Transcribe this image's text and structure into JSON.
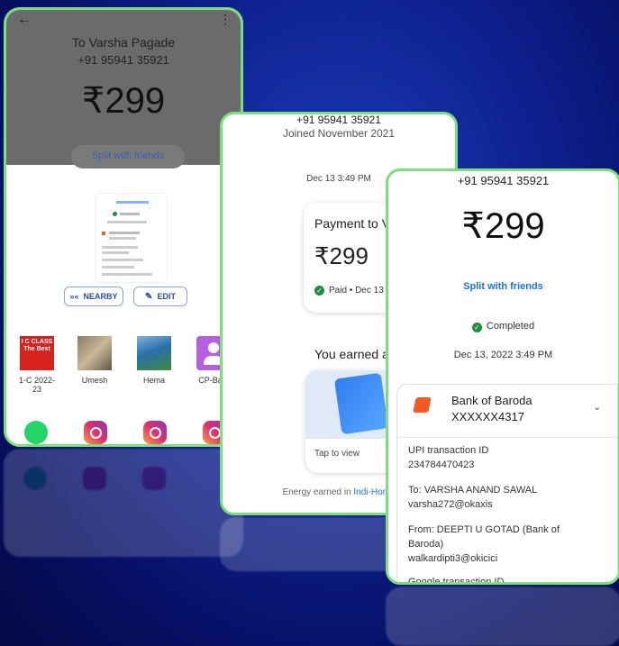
{
  "phone1": {
    "recipient": "To Varsha Pagade",
    "phone": "+91 95941 35921",
    "amount": "₹299",
    "split_label": "Split with friends",
    "nearby_label": "NEARBY",
    "edit_label": "EDIT",
    "contacts": [
      {
        "label": "1-C 2022-23",
        "avatar_text": "I C CLASS The Best"
      },
      {
        "label": "Umesh"
      },
      {
        "label": "Hema"
      },
      {
        "label": "CP-Baja"
      }
    ]
  },
  "phone2": {
    "phone": "+91 95941 35921",
    "joined": "Joined November 2021",
    "date": "Dec 13 3:49 PM",
    "payment_title": "Payment to V",
    "amount": "₹299",
    "status": "Paid • Dec 13",
    "earned": "You earned a",
    "tap": "Tap to view",
    "footer_prefix": "Energy earned in ",
    "footer_link": "Indi-Home"
  },
  "phone3": {
    "phone": "+91 95941 35921",
    "amount": "₹299",
    "split_label": "Split with friends",
    "status": "Completed",
    "date": "Dec 13, 2022 3:49 PM",
    "bank_name": "Bank of Baroda",
    "account": "XXXXXX4317",
    "upi_label": "UPI transaction ID",
    "upi_id": "234784470423",
    "to_line": "To: VARSHA ANAND SAWAL",
    "to_vpa": "varsha272@okaxis",
    "from_line1": "From: DEEPTI U GOTAD (Bank of",
    "from_line2": "Baroda)",
    "from_vpa": "walkardipti3@okicici",
    "google_label": "Google transaction ID"
  },
  "colors": {
    "accent_green": "#7be07b",
    "link_blue": "#1a73e8",
    "status_green": "#1e8e3e",
    "bank_orange": "#f15a22"
  }
}
